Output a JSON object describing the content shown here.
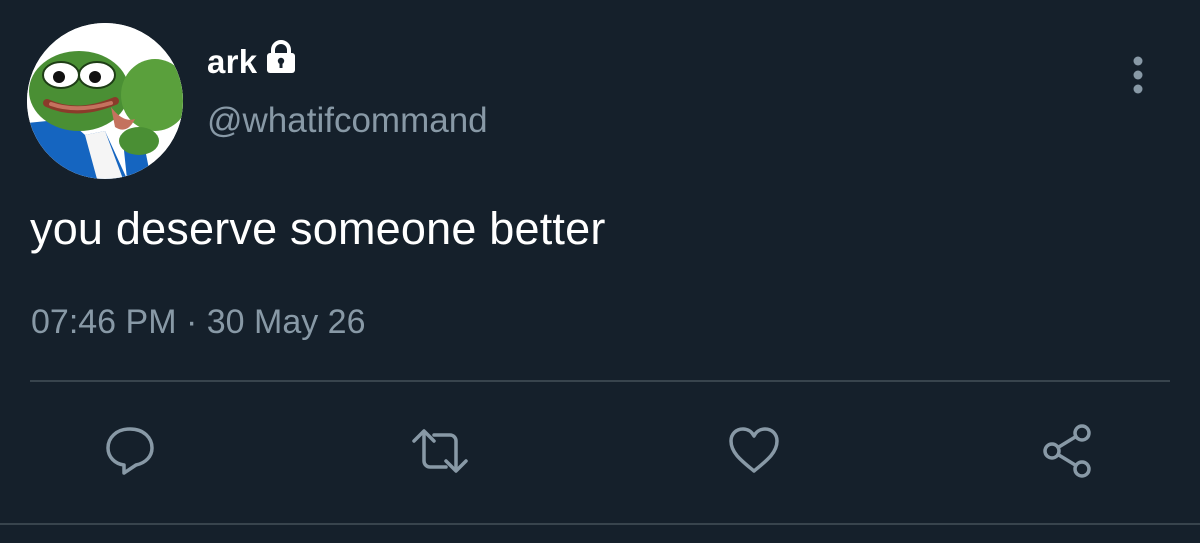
{
  "tweet": {
    "author": {
      "display_name": "ark",
      "handle": "@whatifcommand",
      "protected_icon": "lock-icon",
      "avatar": "frog-avatar"
    },
    "text": "you deserve someone better",
    "timestamp": "07:46 PM · 30 May 26",
    "actions": [
      {
        "name": "reply",
        "icon": "reply-icon"
      },
      {
        "name": "retweet",
        "icon": "retweet-icon"
      },
      {
        "name": "like",
        "icon": "heart-icon"
      },
      {
        "name": "share",
        "icon": "share-icon"
      }
    ],
    "menu_icon": "more-vertical-icon"
  },
  "colors": {
    "background": "#15202b",
    "primary_text": "#ffffff",
    "secondary_text": "#8899a6",
    "divider": "#38444d"
  }
}
